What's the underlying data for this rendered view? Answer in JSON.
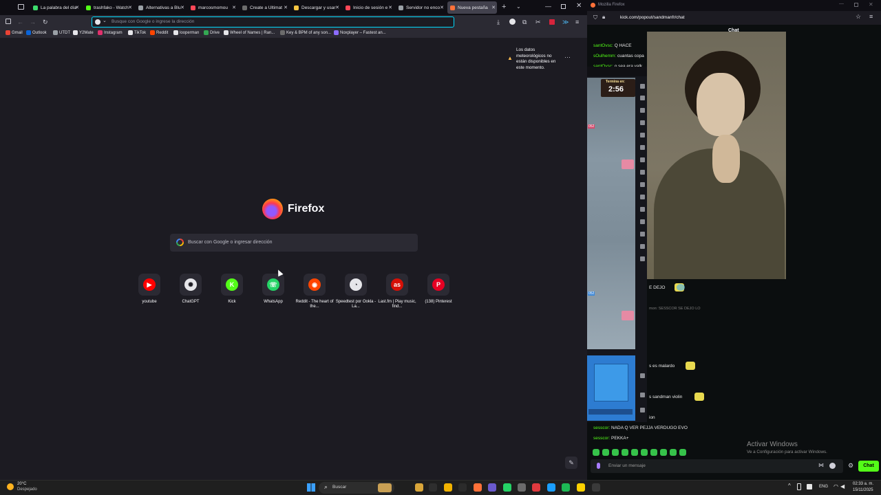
{
  "firefox": {
    "tabs": [
      {
        "label": "La palabra del día",
        "color": "#3ddc6d"
      },
      {
        "label": "trashfako - Watch",
        "color": "#53fc18"
      },
      {
        "label": "Alternativas a Blu",
        "color": "#9aa0a6"
      },
      {
        "label": "marcosmomou",
        "color": "#ff4757"
      },
      {
        "label": "Create a Ultimat",
        "color": "#6c6c6c"
      },
      {
        "label": "Descargar y usar",
        "color": "#f4c542"
      },
      {
        "label": "Inicio de sesión e",
        "color": "#ff4757"
      },
      {
        "label": "Servidor no enco",
        "color": "#9aa0a6"
      },
      {
        "label": "Nueva pestaña",
        "color": "#ff7139"
      }
    ],
    "urlbar_placeholder": "Busque con Google o ingrese la dirección",
    "bookmarks": [
      {
        "label": "Gmail",
        "color": "#ea4335"
      },
      {
        "label": "Outlook",
        "color": "#0a64d8"
      },
      {
        "label": "UTDT",
        "color": "#9aa0a6"
      },
      {
        "label": "Y2Mate",
        "color": "#e6e6ea"
      },
      {
        "label": "Instagram",
        "color": "#e1306c"
      },
      {
        "label": "TikTok",
        "color": "#e6e6ea"
      },
      {
        "label": "Reddit",
        "color": "#ff4500"
      },
      {
        "label": "looperman",
        "color": "#e6e6ea"
      },
      {
        "label": "Drive",
        "color": "#34a853"
      },
      {
        "label": "Wheel of Names | Ran...",
        "color": "#e6e6ea"
      },
      {
        "label": "Key & BPM of any son...",
        "color": "#6c6c6c"
      },
      {
        "label": "Noxplayer – Fastest an...",
        "color": "#8c6cff"
      }
    ],
    "weather_notice": "Los datos meteorológicos no están disponibles en este momento.",
    "brand": "Firefox",
    "search_placeholder": "Buscar con Google o ingresar dirección",
    "shortcuts": [
      {
        "label": "youtube",
        "color": "#ff0000",
        "glyph": "▶"
      },
      {
        "label": "ChatGPT",
        "color": "#e6e6ea",
        "glyph": "✺"
      },
      {
        "label": "Kick",
        "color": "#53fc18",
        "glyph": "K"
      },
      {
        "label": "WhatsApp",
        "color": "#25d366",
        "glyph": "☏"
      },
      {
        "label": "Reddit - The heart of the...",
        "color": "#ff4500",
        "glyph": "◉"
      },
      {
        "label": "Speedtest por Ookla - La...",
        "color": "#e6e6ea",
        "glyph": "◔"
      },
      {
        "label": "Last.fm | Play music, find...",
        "color": "#d51007",
        "glyph": "as"
      },
      {
        "label": "(138) Pinterest",
        "color": "#e60023",
        "glyph": "P"
      }
    ]
  },
  "kick": {
    "window_title": "Mozilla Firefox",
    "url": "kick.com/popout/sandmanfr/chat",
    "chat_header": "Chat",
    "messages": [
      {
        "user": "santOvsc:",
        "text": "Q HACE"
      },
      {
        "user": "sOulhemm:",
        "text": "cuantas copa"
      },
      {
        "user": "santOvsc:",
        "text": "o sea era valk"
      }
    ],
    "game_overlay": {
      "timer_label": "Termina en:",
      "timer_value": "2:56",
      "score_top": "052",
      "score_bottom": "052"
    },
    "partial_messages": [
      "E DEJO",
      "mon: SESSCOR SE DEJO LO",
      "s es malardo",
      "s sandman violin",
      "ion"
    ],
    "bottom_messages": [
      {
        "user": "sesscor:",
        "text": "NADA Q VER PEJJA VERDUGO EVO"
      },
      {
        "user": "sesscor:",
        "text": "PEKKA+"
      }
    ],
    "input_placeholder": "Enviar un mensaje",
    "chat_button": "Chat",
    "watermark_title": "Activar Windows",
    "watermark_sub": "Ve a Configuración para activar Windows."
  },
  "taskbar": {
    "weather_temp": "20°C",
    "weather_desc": "Despejado",
    "search_label": "Buscar",
    "lang": "ENG",
    "time": "02:33 a. m.",
    "date": "15/11/2025"
  }
}
